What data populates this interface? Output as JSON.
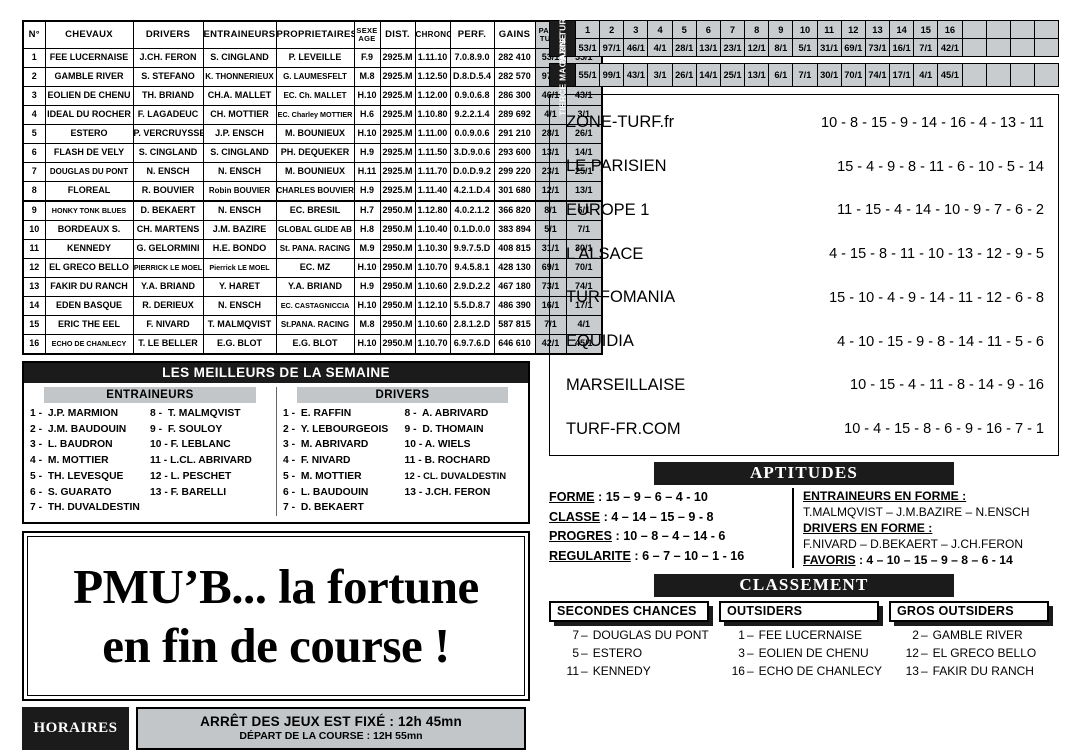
{
  "partants": {
    "headers": [
      "N°",
      "CHEVAUX",
      "DRIVERS",
      "ENTRAINEURS",
      "PROPRIETAIRES",
      "SEXE AGE",
      "DIST.",
      "CHRONO",
      "PERF.",
      "GAINS",
      "PARIS TURF",
      "TIERCE MAGAZINE"
    ],
    "rows": [
      {
        "num": "1",
        "cheval": "FEE LUCERNAISE",
        "driver": "J.CH. FERON",
        "entraineur": "S. CINGLAND",
        "proprietaire": "P. LEVEILLE",
        "sexe": "F.9",
        "dist": "2925.M",
        "chrono": "1.11.10",
        "perf": "7.0.8.9.0",
        "gains": "282 410",
        "paris": "53/1",
        "tierce": "55/1"
      },
      {
        "num": "2",
        "cheval": "GAMBLE RIVER",
        "driver": "S. STEFANO",
        "entraineur": "K. THONNERIEUX",
        "proprietaire": "G. LAUMESFELT",
        "sexe": "M.8",
        "dist": "2925.M",
        "chrono": "1.12.50",
        "perf": "D.8.D.5.4",
        "gains": "282 570",
        "paris": "97/1",
        "tierce": "99/1"
      },
      {
        "num": "3",
        "cheval": "EOLIEN DE CHENU",
        "driver": "TH. BRIAND",
        "entraineur": "CH.A. MALLET",
        "proprietaire": "EC. Ch. MALLET",
        "sexe": "H.10",
        "dist": "2925.M",
        "chrono": "1.12.00",
        "perf": "0.9.0.6.8",
        "gains": "286 300",
        "paris": "46/1",
        "tierce": "43/1"
      },
      {
        "num": "4",
        "cheval": "IDEAL DU ROCHER",
        "driver": "F. LAGADEUC",
        "entraineur": "CH. MOTTIER",
        "proprietaire": "EC. Charley MOTTIER",
        "sexe": "H.6",
        "dist": "2925.M",
        "chrono": "1.10.80",
        "perf": "9.2.2.1.4",
        "gains": "289 692",
        "paris": "4/1",
        "tierce": "3/1"
      },
      {
        "num": "5",
        "cheval": "ESTERO",
        "driver": "P. VERCRUYSSE",
        "entraineur": "J.P. ENSCH",
        "proprietaire": "M. BOUNIEUX",
        "sexe": "H.10",
        "dist": "2925.M",
        "chrono": "1.11.00",
        "perf": "0.0.9.0.6",
        "gains": "291 210",
        "paris": "28/1",
        "tierce": "26/1"
      },
      {
        "num": "6",
        "cheval": "FLASH DE VELY",
        "driver": "S. CINGLAND",
        "entraineur": "S. CINGLAND",
        "proprietaire": "PH. DEQUEKER",
        "sexe": "H.9",
        "dist": "2925.M",
        "chrono": "1.11.50",
        "perf": "3.D.9.0.6",
        "gains": "293 600",
        "paris": "13/1",
        "tierce": "14/1"
      },
      {
        "num": "7",
        "cheval": "DOUGLAS DU PONT",
        "driver": "N. ENSCH",
        "entraineur": "N. ENSCH",
        "proprietaire": "M. BOUNIEUX",
        "sexe": "H.11",
        "dist": "2925.M",
        "chrono": "1.11.70",
        "perf": "D.0.D.9.2",
        "gains": "299 220",
        "paris": "23/1",
        "tierce": "25/1"
      },
      {
        "num": "8",
        "cheval": "FLOREAL",
        "driver": "R. BOUVIER",
        "entraineur": "Robin BOUVIER",
        "proprietaire": "CHARLES BOUVIER",
        "sexe": "H.9",
        "dist": "2925.M",
        "chrono": "1.11.40",
        "perf": "4.2.1.D.4",
        "gains": "301 680",
        "paris": "12/1",
        "tierce": "13/1"
      },
      {
        "num": "9",
        "cheval": "HONKY TONK BLUES",
        "driver": "D. BEKAERT",
        "entraineur": "N. ENSCH",
        "proprietaire": "EC. BRESIL",
        "sexe": "H.7",
        "dist": "2950.M",
        "chrono": "1.12.80",
        "perf": "4.0.2.1.2",
        "gains": "366 820",
        "paris": "8/1",
        "tierce": "6/1"
      },
      {
        "num": "10",
        "cheval": "BORDEAUX S.",
        "driver": "CH. MARTENS",
        "entraineur": "J.M. BAZIRE",
        "proprietaire": "GLOBAL GLIDE AB",
        "sexe": "H.8",
        "dist": "2950.M",
        "chrono": "1.10.40",
        "perf": "0.1.D.0.0",
        "gains": "383 894",
        "paris": "5/1",
        "tierce": "7/1"
      },
      {
        "num": "11",
        "cheval": "KENNEDY",
        "driver": "G. GELORMINI",
        "entraineur": "H.E. BONDO",
        "proprietaire": "St. PANA. RACING",
        "sexe": "M.9",
        "dist": "2950.M",
        "chrono": "1.10.30",
        "perf": "9.9.7.5.D",
        "gains": "408 815",
        "paris": "31/1",
        "tierce": "30/1"
      },
      {
        "num": "12",
        "cheval": "EL GRECO BELLO",
        "driver": "PIERRICK LE MOEL",
        "entraineur": "Pierrick LE MOEL",
        "proprietaire": "EC. MZ",
        "sexe": "H.10",
        "dist": "2950.M",
        "chrono": "1.10.70",
        "perf": "9.4.5.8.1",
        "gains": "428 130",
        "paris": "69/1",
        "tierce": "70/1"
      },
      {
        "num": "13",
        "cheval": "FAKIR DU RANCH",
        "driver": "Y.A. BRIAND",
        "entraineur": "Y. HARET",
        "proprietaire": "Y.A. BRIAND",
        "sexe": "H.9",
        "dist": "2950.M",
        "chrono": "1.10.60",
        "perf": "2.9.D.2.2",
        "gains": "467 180",
        "paris": "73/1",
        "tierce": "74/1"
      },
      {
        "num": "14",
        "cheval": "EDEN BASQUE",
        "driver": "R. DERIEUX",
        "entraineur": "N. ENSCH",
        "proprietaire": "EC. CASTAGNICCIA",
        "sexe": "H.10",
        "dist": "2950.M",
        "chrono": "1.12.10",
        "perf": "5.5.D.8.7",
        "gains": "486 390",
        "paris": "16/1",
        "tierce": "17/1"
      },
      {
        "num": "15",
        "cheval": "ERIC THE EEL",
        "driver": "F. NIVARD",
        "entraineur": "T. MALMQVIST",
        "proprietaire": "St.PANA. RACING",
        "sexe": "M.8",
        "dist": "2950.M",
        "chrono": "1.10.60",
        "perf": "2.8.1.2.D",
        "gains": "587 815",
        "paris": "7/1",
        "tierce": "4/1"
      },
      {
        "num": "16",
        "cheval": "ECHO DE CHANLECY",
        "driver": "T. LE BELLER",
        "entraineur": "E.G. BLOT",
        "proprietaire": "E.G. BLOT",
        "sexe": "H.10",
        "dist": "2950.M",
        "chrono": "1.10.70",
        "perf": "6.9.7.6.D",
        "gains": "646 610",
        "paris": "42/1",
        "tierce": "45/1"
      }
    ]
  },
  "meilleurs": {
    "title": "LES MEILLEURS DE LA SEMAINE",
    "entraineurs_head": "ENTRAINEURS",
    "drivers_head": "DRIVERS",
    "entraineurs": [
      {
        "n": "1 -",
        "name": "J.P. MARMION"
      },
      {
        "n": "2 -",
        "name": "J.M. BAUDOUIN"
      },
      {
        "n": "3 -",
        "name": "L. BAUDRON"
      },
      {
        "n": "4 -",
        "name": "M. MOTTIER"
      },
      {
        "n": "5 -",
        "name": "TH. LEVESQUE"
      },
      {
        "n": "6 -",
        "name": "S. GUARATO"
      },
      {
        "n": "7 -",
        "name": "TH. DUVALDESTIN"
      },
      {
        "n": "8 -",
        "name": "T. MALMQVIST"
      },
      {
        "n": "9 -",
        "name": "F. SOULOY"
      },
      {
        "n": "10 -",
        "name": "F. LEBLANC"
      },
      {
        "n": "11 -",
        "name": "L.CL. ABRIVARD"
      },
      {
        "n": "12 -",
        "name": "L. PESCHET"
      },
      {
        "n": "13 -",
        "name": "F. BARELLI"
      }
    ],
    "drivers": [
      {
        "n": "1 -",
        "name": "E. RAFFIN"
      },
      {
        "n": "2 -",
        "name": "Y. LEBOURGEOIS"
      },
      {
        "n": "3 -",
        "name": "M. ABRIVARD"
      },
      {
        "n": "4 -",
        "name": "F. NIVARD"
      },
      {
        "n": "5 -",
        "name": "M. MOTTIER"
      },
      {
        "n": "6 -",
        "name": "L. BAUDOUIN"
      },
      {
        "n": "7 -",
        "name": "D. BEKAERT"
      },
      {
        "n": "8 -",
        "name": "A. ABRIVARD"
      },
      {
        "n": "9 -",
        "name": "D. THOMAIN"
      },
      {
        "n": "10 -",
        "name": "A. WIELS"
      },
      {
        "n": "11 -",
        "name": "B. ROCHARD"
      },
      {
        "n": "12 -",
        "name": "CL. DUVALDESTIN"
      },
      {
        "n": "13 -",
        "name": "J.CH. FERON"
      }
    ]
  },
  "advert": {
    "line1": "PMU’B... la fortune",
    "line2": "en fin de course !"
  },
  "horaires": {
    "label": "HORAIRES",
    "line1": "ARRÊT DES JEUX EST FIXÉ : 12h 45mn",
    "line2": "DÉPART DE LA COURSE : 12H 55mn"
  },
  "cotes": {
    "paris_turf_label": "PARIS TURF",
    "tierce_label": "TIERCE MAGAZINE",
    "numbers": [
      "1",
      "2",
      "3",
      "4",
      "5",
      "6",
      "7",
      "8",
      "9",
      "10",
      "11",
      "12",
      "13",
      "14",
      "15",
      "16",
      "",
      "",
      "",
      ""
    ],
    "paris_turf": [
      "53/1",
      "97/1",
      "46/1",
      "4/1",
      "28/1",
      "13/1",
      "23/1",
      "12/1",
      "8/1",
      "5/1",
      "31/1",
      "69/1",
      "73/1",
      "16/1",
      "7/1",
      "42/1",
      "",
      "",
      "",
      ""
    ],
    "tierce": [
      "55/1",
      "99/1",
      "43/1",
      "3/1",
      "26/1",
      "14/1",
      "25/1",
      "13/1",
      "6/1",
      "7/1",
      "30/1",
      "70/1",
      "74/1",
      "17/1",
      "4/1",
      "45/1",
      "",
      "",
      "",
      ""
    ]
  },
  "presse": [
    {
      "source": "ZONE-TURF.fr",
      "selection": "10 - 8 - 15 - 9 - 14 - 16 - 4 - 13 - 11"
    },
    {
      "source": "LE PARISIEN",
      "selection": "15 - 4 - 9 - 8 - 11 - 6 - 10 - 5 - 14"
    },
    {
      "source": "EUROPE 1",
      "selection": "11 - 15 - 4 - 14 - 10 - 9 - 7 - 6 - 2"
    },
    {
      "source": "L'ALSACE",
      "selection": "4 - 15 - 8 - 11 - 10 - 13 - 12 - 9 - 5"
    },
    {
      "source": "TURFOMANIA",
      "selection": "15 - 10 - 4 - 9 - 14 - 11 - 12 - 6 - 8"
    },
    {
      "source": "EQUIDIA",
      "selection": "4 - 10 - 15 - 9 - 8 - 14 - 11 - 5 - 6"
    },
    {
      "source": "MARSEILLAISE",
      "selection": "10 - 15 - 4 - 11 - 8 - 14 - 9 - 16"
    },
    {
      "source": "TURF-FR.COM",
      "selection": "10 - 4 - 15 - 8 - 6 - 9 - 16 - 7 - 1"
    }
  ],
  "aptitudes": {
    "title": "APTITUDES",
    "left": [
      {
        "label": "FORME",
        "sep": " : ",
        "value": "15 – 9 – 6 – 4 - 10"
      },
      {
        "label": "CLASSE",
        "sep": " : ",
        "value": "4 – 14 – 15 – 9 - 8"
      },
      {
        "label": "PROGRES",
        "sep": " : ",
        "value": "10 – 8 – 4 – 14 - 6"
      },
      {
        "label": "REGULARITE",
        "sep": " : ",
        "value": "6 – 7 – 10 – 1 - 16"
      }
    ],
    "right": {
      "entraineurs_head": "ENTRAINEURS EN FORME :",
      "entraineurs_value": "T.MALMQVIST – J.M.BAZIRE – N.ENSCH",
      "drivers_head": "DRIVERS EN FORME :",
      "drivers_value": "F.NIVARD – D.BEKAERT – J.CH.FERON",
      "favoris_head": "FAVORIS",
      "favoris_value": " : 4 – 10 – 15 – 9 – 8 – 6 - 14"
    }
  },
  "classement": {
    "title": "CLASSEMENT",
    "columns": [
      {
        "head": "SECONDES CHANCES",
        "items": [
          {
            "n": "7",
            "name": "DOUGLAS DU PONT"
          },
          {
            "n": "5",
            "name": "ESTERO"
          },
          {
            "n": "11",
            "name": "KENNEDY"
          }
        ]
      },
      {
        "head": "OUTSIDERS",
        "items": [
          {
            "n": "1",
            "name": "FEE LUCERNAISE"
          },
          {
            "n": "3",
            "name": "EOLIEN DE CHENU"
          },
          {
            "n": "16",
            "name": "ECHO DE CHANLECY"
          }
        ]
      },
      {
        "head": "GROS OUTSIDERS",
        "items": [
          {
            "n": "2",
            "name": "GAMBLE RIVER"
          },
          {
            "n": "12",
            "name": "EL GRECO BELLO"
          },
          {
            "n": "13",
            "name": "FAKIR DU RANCH"
          }
        ]
      }
    ]
  },
  "colors": {
    "band": "#1b1b1b",
    "shade": "#c8ccce",
    "subhead": "#c3c6c8"
  }
}
